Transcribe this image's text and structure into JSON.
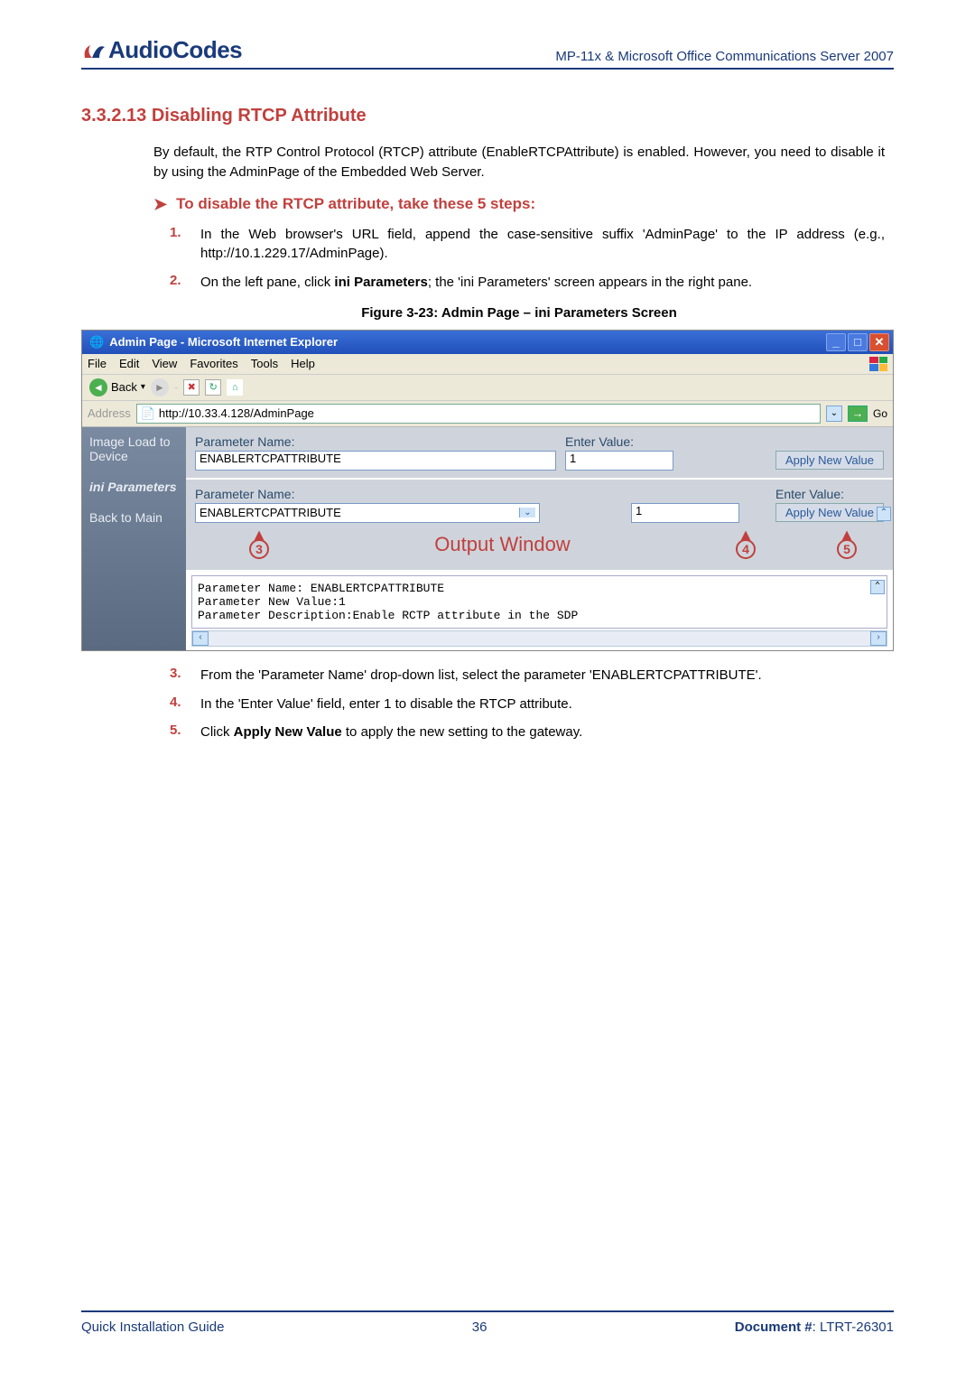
{
  "header": {
    "brand_prefix": "Audio",
    "brand_suffix": "Codes",
    "right": "MP-11x & Microsoft Office Communications Server 2007"
  },
  "section": {
    "number_title": "3.3.2.13  Disabling  RTCP Attribute",
    "intro": "By default, the RTP Control Protocol (RTCP) attribute (EnableRTCPAttribute) is enabled. However, you need to disable it by using the AdminPage of the Embedded Web Server.",
    "subhead": "To disable the RTCP attribute, take these 5 steps:",
    "steps_top": [
      {
        "n": "1.",
        "t": "In the Web browser's URL field, append the case-sensitive suffix 'AdminPage' to the IP address (e.g., http://10.1.229.17/AdminPage)."
      },
      {
        "n": "2.",
        "t_pre": "On the left pane, click ",
        "bold": "ini Parameters",
        "t_post": "; the 'ini Parameters' screen appears in the right pane."
      }
    ],
    "figcap": "Figure 3-23: Admin Page – ini Parameters Screen",
    "steps_bottom": [
      {
        "n": "3.",
        "t": "From the 'Parameter Name' drop-down list, select the parameter 'ENABLERTCPATTRIBUTE'."
      },
      {
        "n": "4.",
        "t": "In the 'Enter Value' field, enter 1 to disable the RTCP attribute."
      },
      {
        "n": "5.",
        "t_pre": "Click ",
        "bold": "Apply New Value",
        "t_post": " to apply the new setting to the gateway."
      }
    ]
  },
  "shot": {
    "title": "Admin Page - Microsoft Internet Explorer",
    "menus": [
      "File",
      "Edit",
      "View",
      "Favorites",
      "Tools",
      "Help"
    ],
    "back": "Back",
    "addr_label": "Address",
    "url": "http://10.33.4.128/AdminPage",
    "go": "Go",
    "left_links": {
      "img": "Image Load to Device",
      "ini": "ini Parameters",
      "back": "Back to Main"
    },
    "panel1": {
      "pname": "Parameter Name:",
      "pval": "ENABLERTCPATTRIBUTE",
      "evlabel": "Enter Value:",
      "evval": "1",
      "apply": "Apply New Value"
    },
    "panel2": {
      "pname": "Parameter Name:",
      "pval": "ENABLERTCPATTRIBUTE",
      "evlabel": "Enter Value:",
      "evval": "1",
      "apply": "Apply New Value",
      "output": "Output Window"
    },
    "outwin": "Parameter Name: ENABLERTCPATTRIBUTE\nParameter New Value:1\nParameter Description:Enable RCTP attribute in the SDP",
    "callouts": {
      "c3": "3",
      "c4": "4",
      "c5": "5"
    }
  },
  "footer": {
    "left": "Quick Installation Guide",
    "center": "36",
    "right_label": "Document #",
    "right_val": ": LTRT-26301"
  }
}
